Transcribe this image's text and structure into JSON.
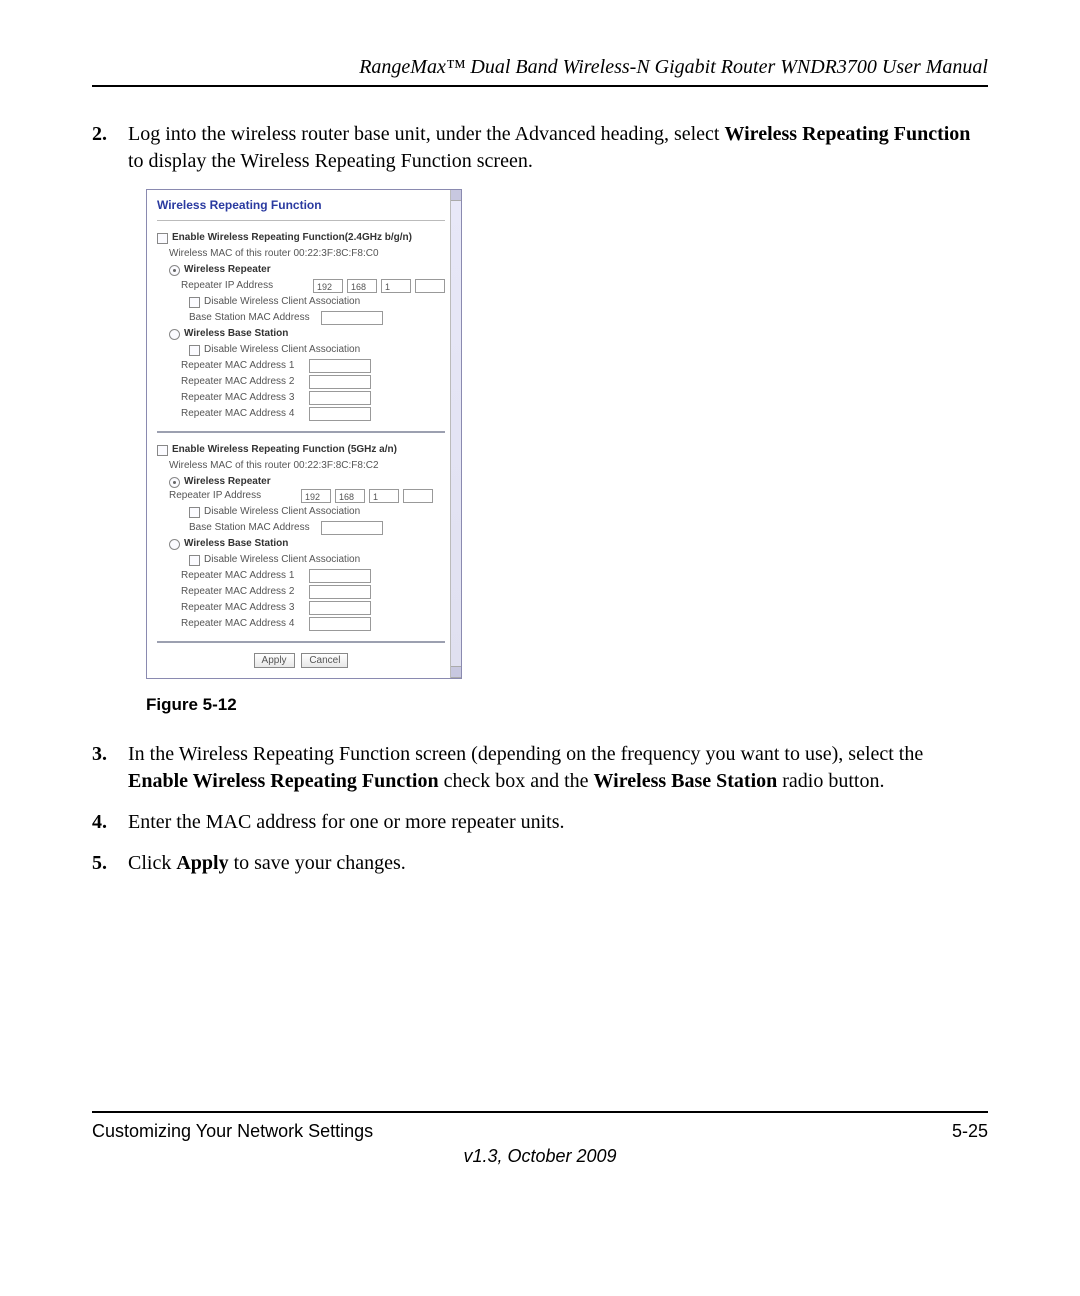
{
  "header": {
    "running_title": "RangeMax™ Dual Band Wireless-N Gigabit Router WNDR3700 User Manual"
  },
  "steps": {
    "s2": {
      "num": "2.",
      "a": "Log into the wireless router base unit, under the Advanced heading, select ",
      "b": "Wireless Repeating Function",
      "c": " to display the Wireless Repeating Function screen."
    },
    "s3": {
      "num": "3.",
      "a": "In the Wireless Repeating Function screen (depending on the frequency you want to use), select the ",
      "b": "Enable Wireless Repeating Function",
      "c": " check box and the ",
      "d": "Wireless Base Station",
      "e": " radio button."
    },
    "s4": {
      "num": "4.",
      "a": "Enter the MAC address for one or more repeater units."
    },
    "s5": {
      "num": "5.",
      "a": "Click ",
      "b": "Apply",
      "c": " to save your changes."
    }
  },
  "figure_caption": "Figure 5-12",
  "screenshot": {
    "title": "Wireless Repeating Function",
    "section24": {
      "enable": "Enable Wireless Repeating Function(2.4GHz b/g/n)",
      "mac": "Wireless MAC of this router 00:22:3F:8C:F8:C0",
      "repeater_heading": "Wireless Repeater",
      "repeater_ip_label": "Repeater IP Address",
      "ip1": "192",
      "ip2": "168",
      "ip3": "1",
      "disable_assoc": "Disable Wireless Client Association",
      "base_mac_label": "Base Station MAC Address",
      "base_heading": "Wireless Base Station",
      "rmac1": "Repeater MAC Address 1",
      "rmac2": "Repeater MAC Address 2",
      "rmac3": "Repeater MAC Address 3",
      "rmac4": "Repeater MAC Address 4"
    },
    "section5": {
      "enable": "Enable Wireless Repeating Function (5GHz a/n)",
      "mac": "Wireless MAC of this router 00:22:3F:8C:F8:C2",
      "repeater_heading": "Wireless Repeater",
      "repeater_ip_label": "Repeater IP Address",
      "ip1": "192",
      "ip2": "168",
      "ip3": "1",
      "disable_assoc": "Disable Wireless Client Association",
      "base_mac_label": "Base Station MAC Address",
      "base_heading": "Wireless Base Station",
      "rmac1": "Repeater MAC Address 1",
      "rmac2": "Repeater MAC Address 2",
      "rmac3": "Repeater MAC Address 3",
      "rmac4": "Repeater MAC Address 4"
    },
    "apply": "Apply",
    "cancel": "Cancel"
  },
  "footer": {
    "left": "Customizing Your Network Settings",
    "right": "5-25",
    "version": "v1.3, October 2009"
  }
}
